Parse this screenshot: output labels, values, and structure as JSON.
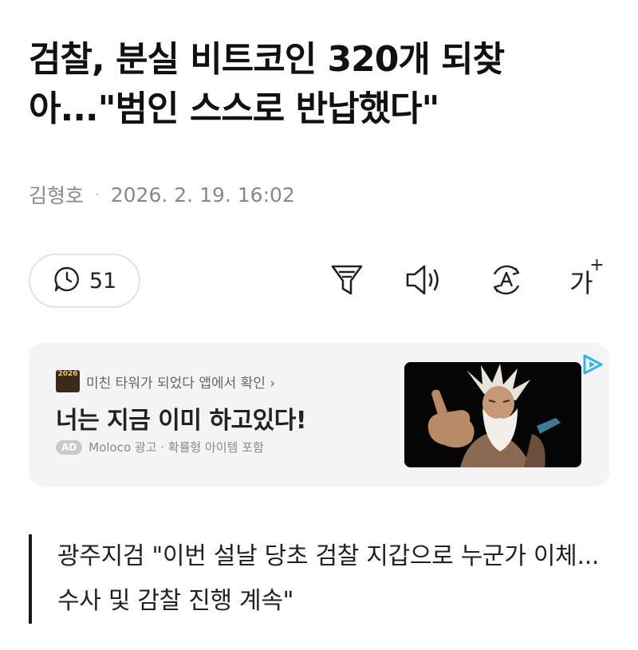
{
  "article": {
    "headline": "검찰, 분실 비트코인 320개 되찾아...\"범인 스스로 반납했다\"",
    "author": "김형호",
    "separator": "·",
    "datetime": "2026. 2. 19. 16:02",
    "subheadline": "광주지검 \"이번 설날 당초 검찰 지갑으로 누군가 이체... 수사 및 감찰 진행 계속\""
  },
  "toolbar": {
    "comment_count": "51",
    "font_size_label": "가",
    "font_size_plus": "+",
    "icons": [
      "comment-icon",
      "summary-filter-icon",
      "speaker-icon",
      "translate-icon",
      "font-size-icon"
    ]
  },
  "ad": {
    "logo_text": "2026",
    "top_line": "미친 타워가 되었다 앱에서 확인 ›",
    "title": "너는 지금 이미 하고있다!",
    "badge": "AD",
    "meta": "Moloco 광고 · 확률형 아이템 포함",
    "colors": {
      "background": "#f4f4f5",
      "image_bg": "#050505",
      "adchoice": "#36b4e5"
    }
  }
}
